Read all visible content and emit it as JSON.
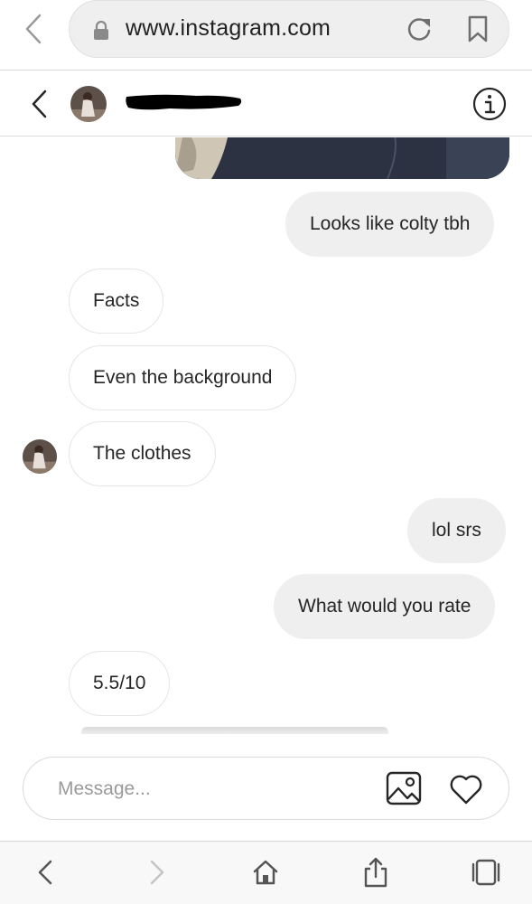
{
  "browser": {
    "url": "www.instagram.com"
  },
  "chat": {
    "contact_name": ""
  },
  "messages": [
    {
      "direction": "outgoing",
      "type": "image"
    },
    {
      "direction": "outgoing",
      "text": "Looks like colty tbh"
    },
    {
      "direction": "incoming",
      "text": "Facts"
    },
    {
      "direction": "incoming",
      "text": "Even the background"
    },
    {
      "direction": "incoming",
      "text": "The clothes"
    },
    {
      "direction": "outgoing",
      "text": "lol srs"
    },
    {
      "direction": "outgoing",
      "text": "What would you rate"
    },
    {
      "direction": "incoming",
      "text": "5.5/10"
    }
  ],
  "composer": {
    "placeholder": "Message..."
  },
  "icons": {
    "browser_back": "chevron-left-icon",
    "lock": "lock-icon",
    "reload": "reload-icon",
    "bookmark": "bookmark-icon",
    "header_back": "chevron-left-icon",
    "info": "info-icon",
    "image": "image-icon",
    "heart": "heart-icon",
    "toolbar": [
      "back-arrow-icon",
      "forward-arrow-icon",
      "home-icon",
      "share-icon",
      "tabs-icon"
    ]
  },
  "colors": {
    "outgoing_bubble": "#efefef",
    "incoming_bubble_border": "#e6e6e6",
    "text": "#262626",
    "placeholder": "#9a9a9a"
  }
}
